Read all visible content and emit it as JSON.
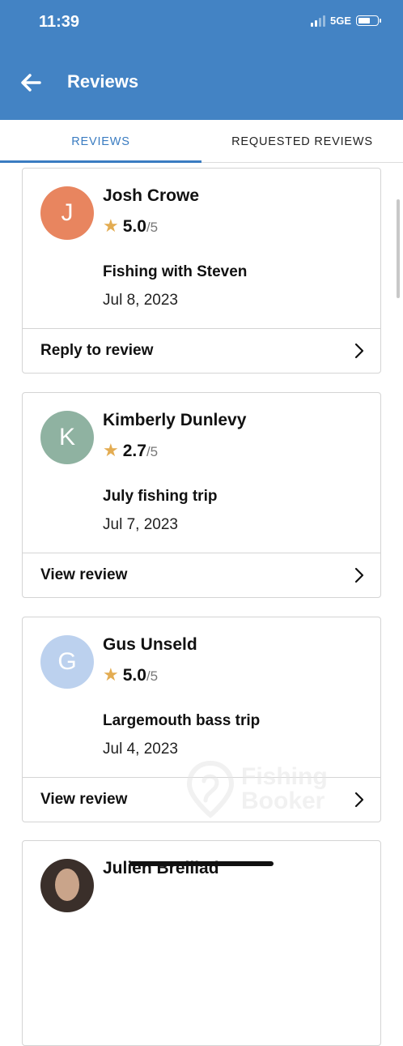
{
  "status_bar": {
    "time": "11:39",
    "network": "5GE"
  },
  "header": {
    "title": "Reviews"
  },
  "tabs": [
    {
      "label": "REVIEWS",
      "active": true
    },
    {
      "label": "REQUESTED REVIEWS",
      "active": false
    }
  ],
  "reviews": [
    {
      "initial": "J",
      "avatar_color": "#e8855f",
      "name": "Josh Crowe",
      "score": "5.0",
      "out_of": "/5",
      "trip": "Fishing with Steven",
      "date": "Jul 8, 2023",
      "action": "Reply to review"
    },
    {
      "initial": "K",
      "avatar_color": "#8fb2a1",
      "name": "Kimberly Dunlevy",
      "score": "2.7",
      "out_of": "/5",
      "trip": "July fishing trip",
      "date": "Jul 7, 2023",
      "action": "View review"
    },
    {
      "initial": "G",
      "avatar_color": "#bcd1ee",
      "name": "Gus Unseld",
      "score": "5.0",
      "out_of": "/5",
      "trip": "Largemouth bass trip",
      "date": "Jul 4, 2023",
      "action": "View review"
    },
    {
      "name": "Julien Breillad"
    }
  ],
  "watermark": {
    "line1": "Fishing",
    "line2": "Booker"
  },
  "colors": {
    "appbar": "#4383c4",
    "accent": "#3a7cc1",
    "star": "#e3ac52"
  },
  "icons": {
    "back": "arrow-left-icon",
    "chevron": "chevron-right-icon",
    "star": "star-icon"
  }
}
